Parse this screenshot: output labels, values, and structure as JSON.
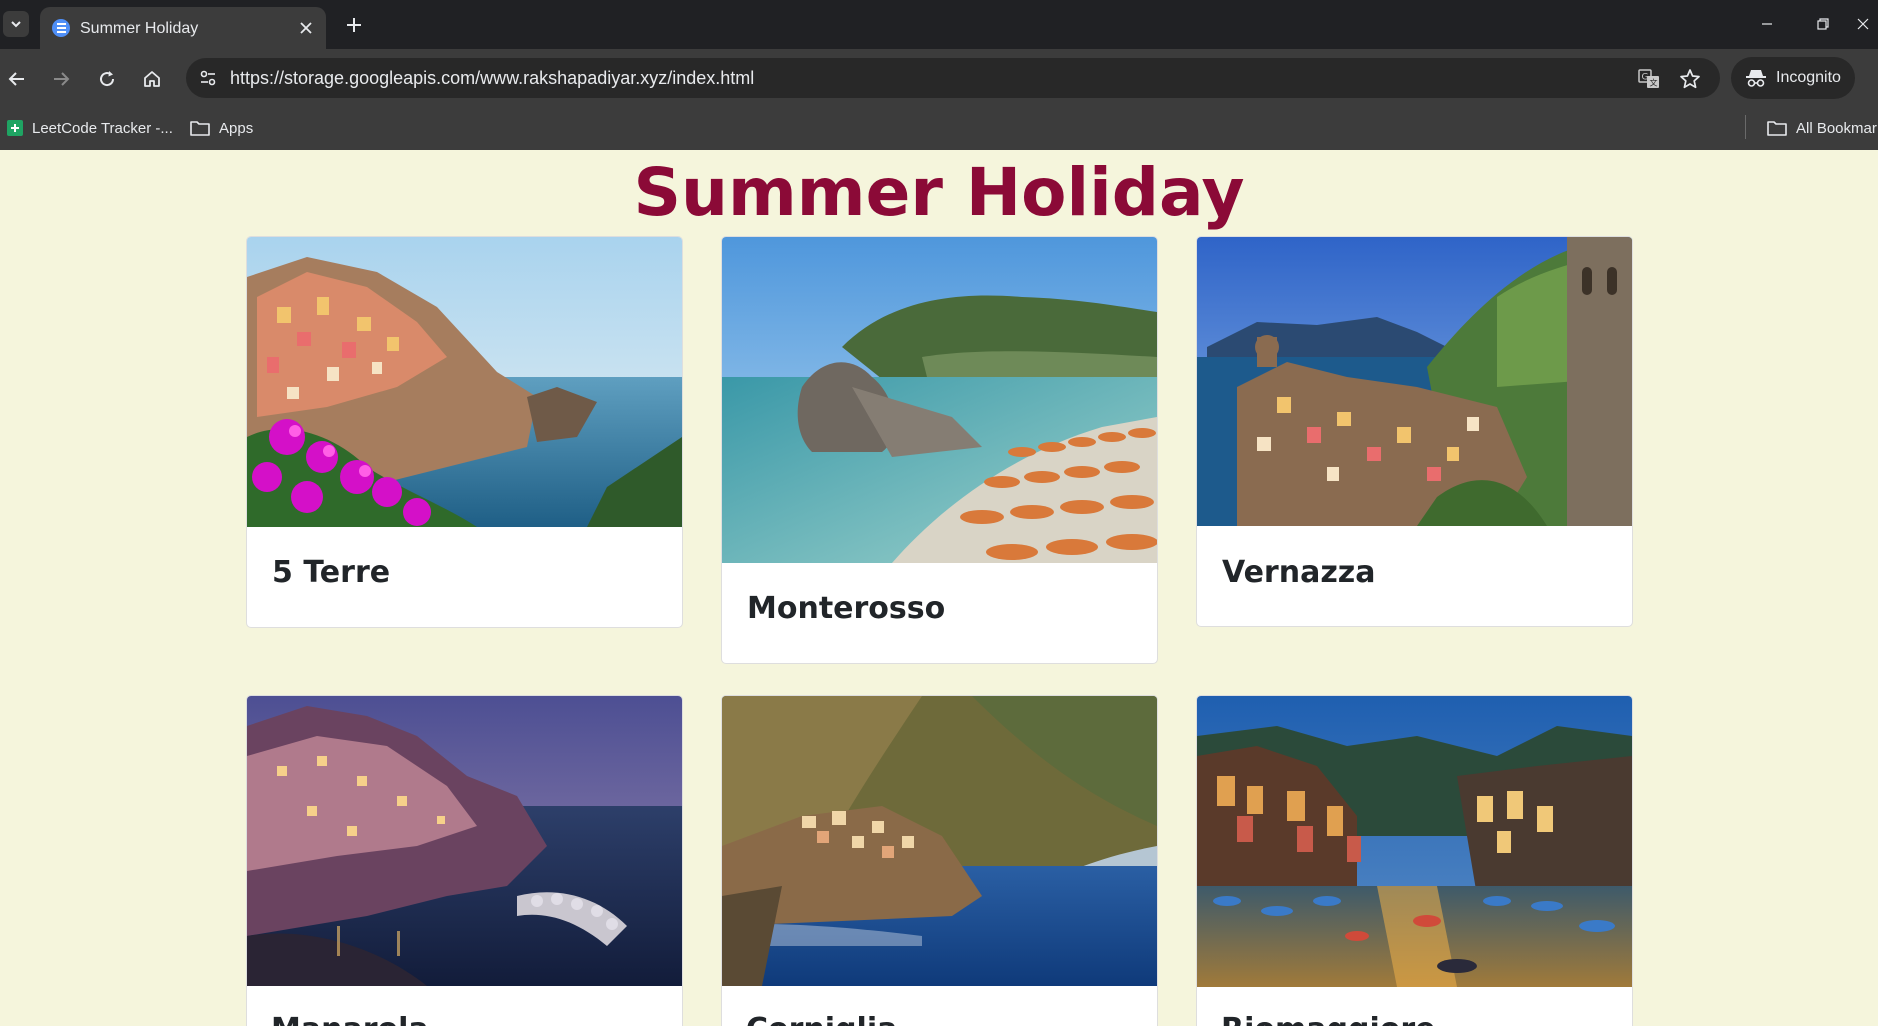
{
  "browser": {
    "tab": {
      "title": "Summer Holiday"
    },
    "url": "https://storage.googleapis.com/www.rakshapadiyar.xyz/index.html",
    "profile_label": "Incognito",
    "bookmarks": [
      {
        "label": "LeetCode Tracker -...",
        "icon": "sheets-icon"
      },
      {
        "label": "Apps",
        "icon": "folder-icon"
      }
    ],
    "all_bookmarks_label": "All Bookmar"
  },
  "page": {
    "title": "Summer Holiday",
    "cards": [
      {
        "title": "5 Terre",
        "image": "manarola-cliffs-with-flowers"
      },
      {
        "title": "Monterosso",
        "image": "monterosso-beach-umbrellas"
      },
      {
        "title": "Vernazza",
        "image": "vernazza-harbor-tower"
      },
      {
        "title": "Manarola",
        "image": "manarola-dusk"
      },
      {
        "title": "Corniglia",
        "image": "corniglia-cliffs"
      },
      {
        "title": "Riomaggiore",
        "image": "riomaggiore-night-harbor"
      }
    ]
  },
  "colors": {
    "page_background": "#f5f5dc",
    "title_color": "#8b0a37",
    "chrome_dark": "#202124",
    "chrome_toolbar": "#3c3c3c"
  }
}
